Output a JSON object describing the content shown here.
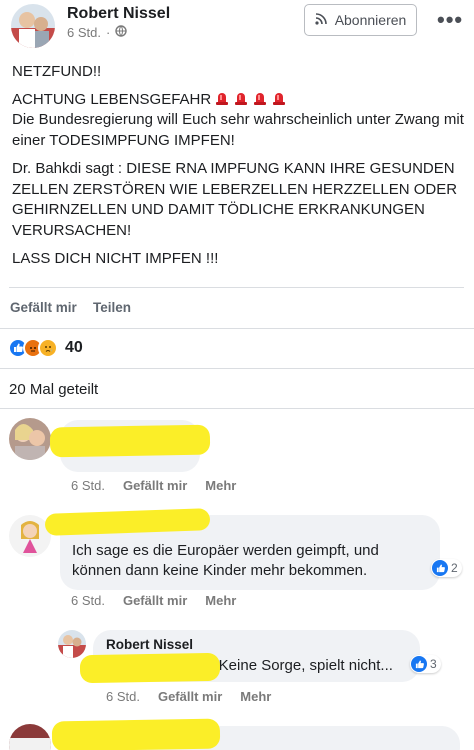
{
  "post": {
    "author": "Robert Nissel",
    "time": "6 Std.",
    "subscribe_label": "Abonnieren",
    "more_label": "•••",
    "paragraphs": {
      "p1": "NETZFUND!!",
      "p2a": "ACHTUNG LEBENSGEFAHR",
      "p2b": "Die Bundesregierung will Euch sehr wahrscheinlich unter Zwang mit einer TODESIMPFUNG IMPFEN!",
      "p3": "Dr. Bahkdi sagt : DIESE RNA IMPFUNG KANN IHRE GESUNDEN ZELLEN ZERSTÖREN WIE LEBERZELLEN HERZZELLEN ODER GEHIRNZELLEN UND DAMIT TÖDLICHE ERKRANKUNGEN VERURSACHEN!",
      "p4": "LASS DICH NICHT IMPFEN !!!"
    },
    "actions": {
      "like": "Gefällt mir",
      "share": "Teilen"
    },
    "reaction_count": "40",
    "shares_text": "20 Mal geteilt",
    "colors": {
      "like_blue": "#1877f2",
      "angry_orange": "#e9710f",
      "sad_yellow": "#f7b125",
      "siren_red": "#e0242c"
    }
  },
  "comments": [
    {
      "text": "",
      "time": "6 Std.",
      "like": "Gefällt mir",
      "reply": "Mehr"
    },
    {
      "text": "Ich sage es die Europäer werden geimpft, und können dann keine Kinder mehr bekommen.",
      "time": "6 Std.",
      "like": "Gefällt mir",
      "reply": "Mehr",
      "like_count": "2"
    },
    {
      "author": "Robert Nissel",
      "text": "s Keine Sorge, spielt nicht...",
      "time": "6 Std.",
      "like": "Gefällt mir",
      "reply": "Mehr",
      "like_count": "3"
    }
  ]
}
